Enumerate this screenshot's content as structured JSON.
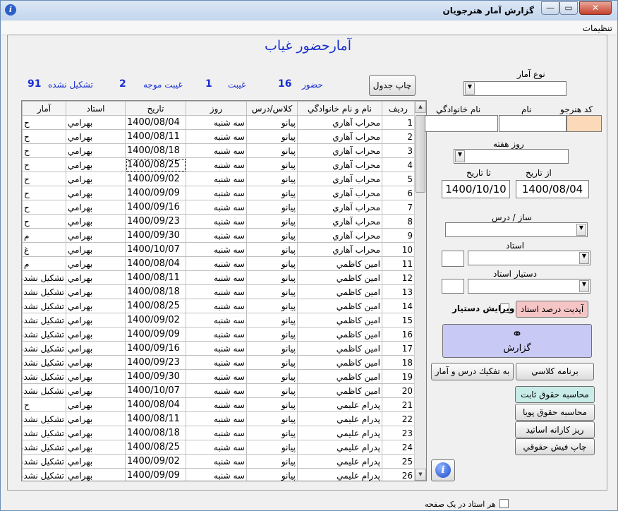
{
  "window": {
    "title": "گزارش آمار هنرجويان"
  },
  "menu": {
    "settings": "تنظيمات"
  },
  "heading": "آمارحضور غياب",
  "stats": {
    "present_label": "حضور",
    "present_value": "16",
    "absent_label": "غيبت",
    "absent_value": "1",
    "excused_label": "غيبت موجه",
    "excused_value": "2",
    "not_formed_label": "تشكيل نشده",
    "not_formed_value": "91"
  },
  "buttons": {
    "print_table": "چاپ جدول",
    "update_teacher_percent": "آپديت درصد استاد",
    "report": "گزارش",
    "class_schedule": "برنامه كلاسي",
    "by_course_stats": "به تفكيك درس و آمار",
    "fixed_salary": "محاسبه حقوق ثابت",
    "dynamic_salary": "محاسبه حقوق پويا",
    "teacher_fees_detail": "ريز كارانه اساتيد",
    "print_pay_slip": "چاپ فيش حقوقي"
  },
  "form": {
    "stat_type_label": "نوع آمار",
    "student_code_label": "كد  هنرجو",
    "name_label": "نام",
    "family_label": "نام خانوادگي",
    "weekday_label": "روز هفته",
    "from_date_label": "از تاريخ",
    "to_date_label": "تا تاريخ",
    "from_date_value": "1400/08/04",
    "to_date_value": "1400/10/10",
    "instrument_label": "ساز / درس",
    "teacher_label": "استاد",
    "assistant_label": "دستيار استاد",
    "edit_assistant_label": "ويرايش دستيار",
    "each_teacher_page_label": "هر استاد در يک صفحه"
  },
  "table": {
    "headers": {
      "row": "رديف",
      "name": "نام و نام خانوادگي",
      "class": "كلاس/درس",
      "day": "روز",
      "date": "تاريخ",
      "teacher": "استاد",
      "stat": "آمار"
    },
    "rows": [
      {
        "n": "1",
        "name": "محراب آهاري",
        "cls": "پيانو",
        "day": "سه شنبه",
        "date": "1400/08/04",
        "teacher": "بهرامي",
        "stat": "ح"
      },
      {
        "n": "2",
        "name": "محراب آهاري",
        "cls": "پيانو",
        "day": "سه شنبه",
        "date": "1400/08/11",
        "teacher": "بهرامي",
        "stat": "ح"
      },
      {
        "n": "3",
        "name": "محراب آهاري",
        "cls": "پيانو",
        "day": "سه شنبه",
        "date": "1400/08/18",
        "teacher": "بهرامي",
        "stat": "ح"
      },
      {
        "n": "4",
        "name": "محراب آهاري",
        "cls": "پيانو",
        "day": "سه شنبه",
        "date": "1400/08/25",
        "teacher": "بهرامي",
        "stat": "ح"
      },
      {
        "n": "5",
        "name": "محراب آهاري",
        "cls": "پيانو",
        "day": "سه شنبه",
        "date": "1400/09/02",
        "teacher": "بهرامي",
        "stat": "ح"
      },
      {
        "n": "6",
        "name": "محراب آهاري",
        "cls": "پيانو",
        "day": "سه شنبه",
        "date": "1400/09/09",
        "teacher": "بهرامي",
        "stat": "ح"
      },
      {
        "n": "7",
        "name": "محراب آهاري",
        "cls": "پيانو",
        "day": "سه شنبه",
        "date": "1400/09/16",
        "teacher": "بهرامي",
        "stat": "ح"
      },
      {
        "n": "8",
        "name": "محراب آهاري",
        "cls": "پيانو",
        "day": "سه شنبه",
        "date": "1400/09/23",
        "teacher": "بهرامي",
        "stat": "ح"
      },
      {
        "n": "9",
        "name": "محراب آهاري",
        "cls": "پيانو",
        "day": "سه شنبه",
        "date": "1400/09/30",
        "teacher": "بهرامي",
        "stat": "م"
      },
      {
        "n": "10",
        "name": "محراب آهاري",
        "cls": "پيانو",
        "day": "سه شنبه",
        "date": "1400/10/07",
        "teacher": "بهرامي",
        "stat": "غ"
      },
      {
        "n": "11",
        "name": "امين كاظمي",
        "cls": "پيانو",
        "day": "سه شنبه",
        "date": "1400/08/04",
        "teacher": "بهرامي",
        "stat": "م"
      },
      {
        "n": "12",
        "name": "امين كاظمي",
        "cls": "پيانو",
        "day": "سه شنبه",
        "date": "1400/08/11",
        "teacher": "بهرامي",
        "stat": "تشكيل نشده"
      },
      {
        "n": "13",
        "name": "امين كاظمي",
        "cls": "پيانو",
        "day": "سه شنبه",
        "date": "1400/08/18",
        "teacher": "بهرامي",
        "stat": "تشكيل نشده"
      },
      {
        "n": "14",
        "name": "امين كاظمي",
        "cls": "پيانو",
        "day": "سه شنبه",
        "date": "1400/08/25",
        "teacher": "بهرامي",
        "stat": "تشكيل نشده"
      },
      {
        "n": "15",
        "name": "امين كاظمي",
        "cls": "پيانو",
        "day": "سه شنبه",
        "date": "1400/09/02",
        "teacher": "بهرامي",
        "stat": "تشكيل نشده"
      },
      {
        "n": "16",
        "name": "امين كاظمي",
        "cls": "پيانو",
        "day": "سه شنبه",
        "date": "1400/09/09",
        "teacher": "بهرامي",
        "stat": "تشكيل نشده"
      },
      {
        "n": "17",
        "name": "امين كاظمي",
        "cls": "پيانو",
        "day": "سه شنبه",
        "date": "1400/09/16",
        "teacher": "بهرامي",
        "stat": "تشكيل نشده"
      },
      {
        "n": "18",
        "name": "امين كاظمي",
        "cls": "پيانو",
        "day": "سه شنبه",
        "date": "1400/09/23",
        "teacher": "بهرامي",
        "stat": "تشكيل نشده"
      },
      {
        "n": "19",
        "name": "امين كاظمي",
        "cls": "پيانو",
        "day": "سه شنبه",
        "date": "1400/09/30",
        "teacher": "بهرامي",
        "stat": "تشكيل نشده"
      },
      {
        "n": "20",
        "name": "امين كاظمي",
        "cls": "پيانو",
        "day": "سه شنبه",
        "date": "1400/10/07",
        "teacher": "بهرامي",
        "stat": "تشكيل نشده"
      },
      {
        "n": "21",
        "name": "پدرام عليمي",
        "cls": "پيانو",
        "day": "سه شنبه",
        "date": "1400/08/04",
        "teacher": "بهرامي",
        "stat": "ح"
      },
      {
        "n": "22",
        "name": "پدرام عليمي",
        "cls": "پيانو",
        "day": "سه شنبه",
        "date": "1400/08/11",
        "teacher": "بهرامي",
        "stat": "تشكيل نشده"
      },
      {
        "n": "23",
        "name": "پدرام عليمي",
        "cls": "پيانو",
        "day": "سه شنبه",
        "date": "1400/08/18",
        "teacher": "بهرامي",
        "stat": "تشكيل نشده"
      },
      {
        "n": "24",
        "name": "پدرام عليمي",
        "cls": "پيانو",
        "day": "سه شنبه",
        "date": "1400/08/25",
        "teacher": "بهرامي",
        "stat": "تشكيل نشده"
      },
      {
        "n": "25",
        "name": "پدرام عليمي",
        "cls": "پيانو",
        "day": "سه شنبه",
        "date": "1400/09/02",
        "teacher": "بهرامي",
        "stat": "تشكيل نشده"
      },
      {
        "n": "26",
        "name": "پدرام عليمي",
        "cls": "پيانو",
        "day": "سه شنبه",
        "date": "1400/09/09",
        "teacher": "بهرامي",
        "stat": "تشكيل نشده"
      }
    ]
  },
  "colors": {
    "accent_blue": "#1a2fd0",
    "report_button": "#c9c9f5",
    "update_button": "#f5c4c4",
    "student_code_field": "#fcd9b8",
    "fixed_salary_button": "#c8ece8"
  },
  "icons": {
    "app": "info-circle-icon",
    "report": "binoculars-icon",
    "help": "info-icon"
  }
}
